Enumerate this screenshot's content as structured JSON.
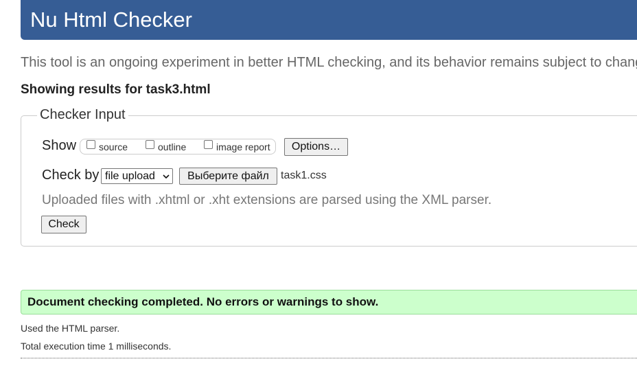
{
  "banner": {
    "title": "Nu Html Checker"
  },
  "intro": {
    "text": "This tool is an ongoing experiment in better HTML checking, and its behavior remains subject to chang"
  },
  "results": {
    "heading": "Showing results for task3.html"
  },
  "checker_input": {
    "legend": "Checker Input",
    "show": {
      "label": "Show",
      "options": [
        {
          "label": "source",
          "checked": false
        },
        {
          "label": "outline",
          "checked": false
        },
        {
          "label": "image report",
          "checked": false
        }
      ],
      "options_button": "Options…"
    },
    "check_by": {
      "label": "Check by",
      "selected": "file upload",
      "file_button": "Выберите файл",
      "file_name": "task1.css"
    },
    "hint": "Uploaded files with .xhtml or .xht extensions are parsed using the XML parser.",
    "check_button": "Check"
  },
  "outcome": {
    "success": "Document checking completed. No errors or warnings to show.",
    "parser": "Used the HTML parser.",
    "time": "Total execution time 1 milliseconds."
  },
  "colors": {
    "banner": "#365d95",
    "success_bg": "#ccffcc",
    "muted_text": "#666666"
  }
}
